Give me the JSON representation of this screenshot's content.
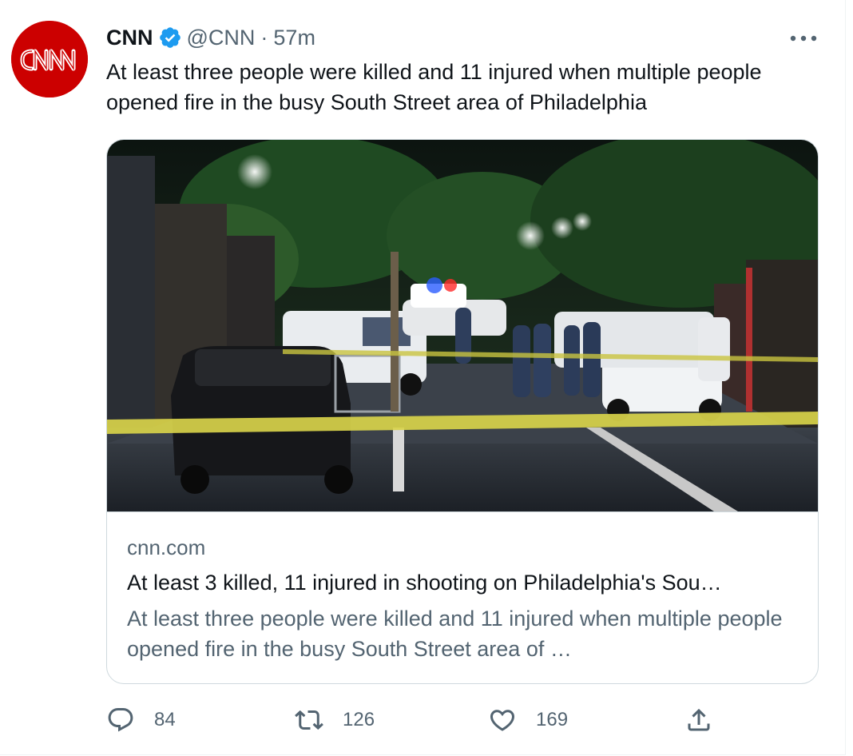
{
  "tweet": {
    "display_name": "CNN",
    "handle": "@CNN",
    "separator": "·",
    "time": "57m",
    "text": "At least three people were killed and 11 injured when multiple people opened fire in the busy South Street area of Philadelphia",
    "avatar_icon": "cnn-logo-icon",
    "verified_icon": "verified-badge-icon",
    "colors": {
      "avatar_bg": "#cc0000",
      "verified": "#1d9bf0",
      "secondary_text": "#536471",
      "border": "#cfd9de"
    }
  },
  "card": {
    "image_description_icon": "news-photo-night-police-scene",
    "domain": "cnn.com",
    "title": "At least 3 killed, 11 injured in shooting on Philadelphia's Sou…",
    "description": "At least three people were killed and 11 injured when multiple people opened fire in the busy South Street area of …"
  },
  "actions": {
    "reply": {
      "icon": "reply-icon",
      "count": "84"
    },
    "retweet": {
      "icon": "retweet-icon",
      "count": "126"
    },
    "like": {
      "icon": "heart-icon",
      "count": "169"
    },
    "share": {
      "icon": "share-icon"
    }
  },
  "menu_icon": "more-options-icon"
}
